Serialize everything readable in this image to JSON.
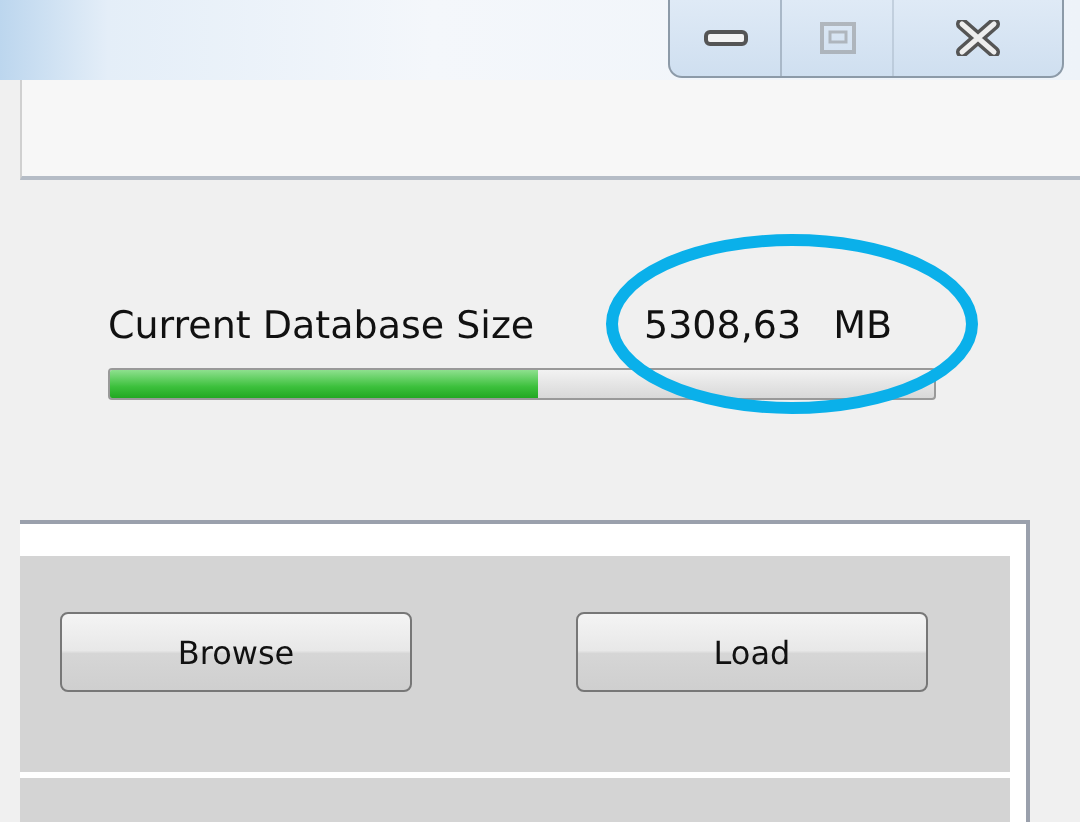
{
  "window_controls": [
    {
      "kind": "minimize",
      "disabled": false
    },
    {
      "kind": "maximize",
      "disabled": true
    },
    {
      "kind": "close",
      "disabled": false
    }
  ],
  "database_size": {
    "label": "Current Database Size",
    "value": "5308,63",
    "unit": "MB",
    "level": 0.52,
    "highlighted": true
  },
  "buttons": [
    "Browse",
    "Load"
  ]
}
